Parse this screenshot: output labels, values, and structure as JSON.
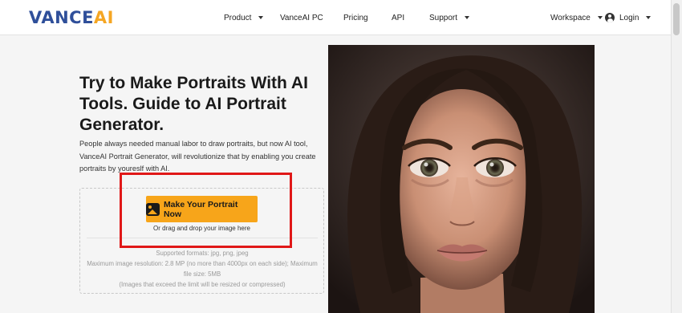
{
  "header": {
    "logo_main": "VANCE",
    "logo_accent": "AI",
    "nav": {
      "product": "Product",
      "pc": "VanceAI PC",
      "pricing": "Pricing",
      "api": "API",
      "support": "Support",
      "workspace": "Workspace",
      "login": "Login"
    }
  },
  "main": {
    "title": "Try to Make Portraits With AI Tools. Guide to AI Portrait Generator.",
    "description": "People always needed manual labor to draw portraits, but now AI tool, VanceAI Portrait Generator, will revolutionize that by enabling you create portraits by youreslf with AI.",
    "upload_button": "Make Your Portrait Now",
    "drag_hint": "Or drag and drop your image here",
    "formats": {
      "supported": "Supported formats: jpg, png, jpeg",
      "resolution": "Maximum image resolution: 2.8 MP (no more than 4000px on each side); Maximum file size: 5MB",
      "note": "(Images that exceed the limit will be resized or compressed)"
    }
  },
  "colors": {
    "brand_blue": "#2f4f9a",
    "brand_orange": "#f5a623",
    "button": "#f7a51a",
    "highlight": "#e01818"
  }
}
